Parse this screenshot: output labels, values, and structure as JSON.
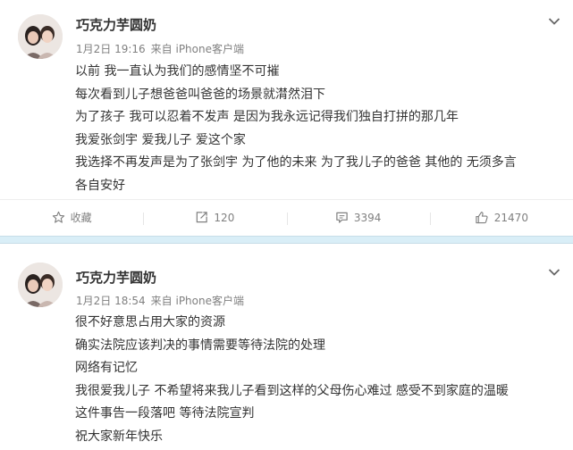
{
  "posts": [
    {
      "author": "巧克力芋圆奶",
      "time": "1月2日 19:16",
      "source": "来自 iPhone客户端",
      "lines": [
        "以前 我一直认为我们的感情坚不可摧",
        "每次看到儿子想爸爸叫爸爸的场景就潸然泪下",
        "为了孩子 我可以忍着不发声 是因为我永远记得我们独自打拼的那几年",
        "我爱张剑宇 爱我儿子 爱这个家",
        "我选择不再发声是为了张剑宇 为了他的未来 为了我儿子的爸爸 其他的 无须多言",
        "各自安好"
      ],
      "actions": {
        "favorite": "收藏",
        "repost": "120",
        "comment": "3394",
        "like": "21470"
      }
    },
    {
      "author": "巧克力芋圆奶",
      "time": "1月2日 18:54",
      "source": "来自 iPhone客户端",
      "lines": [
        "很不好意思占用大家的资源",
        "确实法院应该判决的事情需要等待法院的处理",
        "网络有记忆",
        "我很爱我儿子 不希望将来我儿子看到这样的父母伤心难过 感受不到家庭的温暖",
        "这件事告一段落吧 等待法院宣判",
        "祝大家新年快乐"
      ]
    }
  ],
  "icons": [
    "avatar",
    "chevron-down-icon",
    "star-icon",
    "repost-icon",
    "comment-icon",
    "thumbs-up-icon"
  ],
  "colors": {
    "text": "#333333",
    "meta": "#808080",
    "separator": "#d9eef7"
  }
}
